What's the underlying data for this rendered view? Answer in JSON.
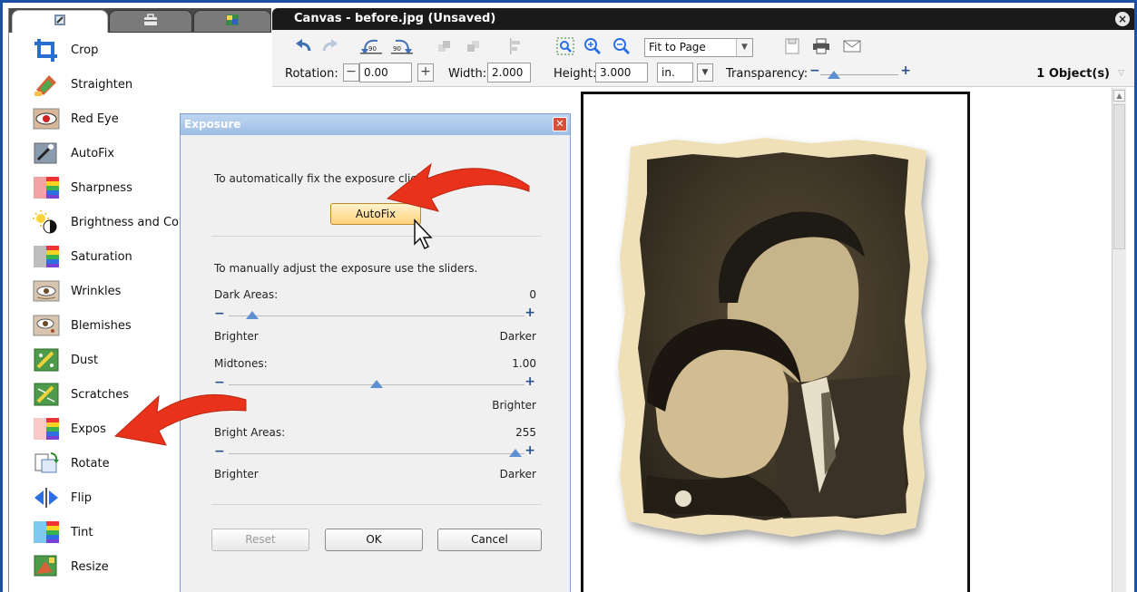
{
  "left_panel": {
    "tabs": [
      {
        "icon": "tools-tab-icon"
      },
      {
        "icon": "briefcase-tab-icon"
      },
      {
        "icon": "image-tab-icon"
      }
    ],
    "tools": [
      {
        "label": "Crop",
        "icon": "crop-icon"
      },
      {
        "label": "Straighten",
        "icon": "straighten-icon"
      },
      {
        "label": "Red Eye",
        "icon": "red-eye-icon"
      },
      {
        "label": "AutoFix",
        "icon": "autofix-icon"
      },
      {
        "label": "Sharpness",
        "icon": "sharpness-icon"
      },
      {
        "label": "Brightness and Cor",
        "icon": "brightness-icon"
      },
      {
        "label": "Saturation",
        "icon": "saturation-icon"
      },
      {
        "label": "Wrinkles",
        "icon": "wrinkles-icon"
      },
      {
        "label": "Blemishes",
        "icon": "blemishes-icon"
      },
      {
        "label": "Dust",
        "icon": "dust-icon"
      },
      {
        "label": "Scratches",
        "icon": "scratches-icon"
      },
      {
        "label": "Expos",
        "icon": "exposure-icon"
      },
      {
        "label": "Rotate",
        "icon": "rotate-icon"
      },
      {
        "label": "Flip",
        "icon": "flip-icon"
      },
      {
        "label": "Tint",
        "icon": "tint-icon"
      },
      {
        "label": "Resize",
        "icon": "resize-icon"
      }
    ]
  },
  "canvas": {
    "title": "Canvas - before.jpg (Unsaved)",
    "close_icon": "close-icon",
    "zoom_value": "Fit to Page",
    "rotation_label": "Rotation:",
    "rotation_value": "0.00",
    "width_label": "Width:",
    "width_value": "2.000",
    "height_label": "Height:",
    "height_value": "3.000",
    "unit_value": "in.",
    "transparency_label": "Transparency:",
    "object_count": "1 Object(s)",
    "minus_glyph": "−",
    "plus_glyph": "+",
    "rotate_left_label": "90",
    "rotate_right_label": "90"
  },
  "dialog": {
    "title": "Exposure",
    "auto_text": "To automatically fix the exposure clic",
    "auto_text_tail": "k",
    "autofix_button": "AutoFix",
    "manual_text": "To manually adjust the exposure use the sliders.",
    "dark": {
      "label": "Dark Areas:",
      "value": "0",
      "left": "Brighter",
      "right": "Darker",
      "level": 0.08
    },
    "mid": {
      "label": "Midtones:",
      "value": "1.00",
      "left": "er",
      "right": "Brighter",
      "level": 0.5
    },
    "bright": {
      "label": "Bright Areas:",
      "value": "255",
      "left": "Brighter",
      "right": "Darker",
      "level": 0.97
    },
    "reset_button": "Reset",
    "ok_button": "OK",
    "cancel_button": "Cancel"
  },
  "colors": {
    "annotation_arrow": "#e8321c",
    "title_bar": "#1a1a1a",
    "frame_border": "#1c4fa6"
  }
}
